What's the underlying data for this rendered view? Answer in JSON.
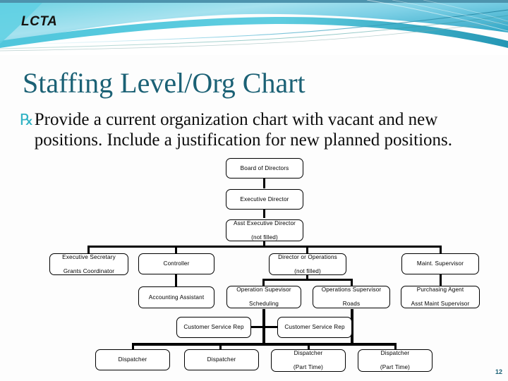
{
  "slide": {
    "logo": "LCTA",
    "title": "Staffing Level/Org Chart",
    "bullet_glyph": "℞",
    "bullet_text": "Provide a current organization chart with vacant and new positions.  Include a justification for new planned positions.",
    "page_number": "12",
    "colors": {
      "title": "#1b6175",
      "bullet": "#31b3c4",
      "banner_light": "#bfe8f2",
      "banner_mid": "#54c6db",
      "banner_deep": "#2a9cb5",
      "page_number": "#1b6175",
      "node_border": "#000000",
      "node_fill": "#ffffff"
    }
  },
  "chart_data": {
    "type": "diagram",
    "title": "Organization Chart",
    "nodes": [
      {
        "id": "board",
        "label": "Board of Directors",
        "lines": [
          "Board of Directors"
        ]
      },
      {
        "id": "execdir",
        "label": "Executive Director",
        "lines": [
          "Executive Director"
        ]
      },
      {
        "id": "asstexec",
        "label": "Asst Executive Director (not filled)",
        "lines": [
          "Asst Executive Director",
          "(not filled)"
        ]
      },
      {
        "id": "execsec",
        "label": "Executive Secretary Grants Coordinator",
        "lines": [
          "Executive Secretary",
          "Grants Coordinator"
        ]
      },
      {
        "id": "controller",
        "label": "Controller",
        "lines": [
          "Controller"
        ]
      },
      {
        "id": "dirops",
        "label": "Director or Operations (not filled)",
        "lines": [
          "Director or Operations",
          "(not filled)"
        ]
      },
      {
        "id": "maintsup",
        "label": "Maint. Supervisor",
        "lines": [
          "Maint. Supervisor"
        ]
      },
      {
        "id": "acctasst",
        "label": "Accounting Assistant",
        "lines": [
          "Accounting Assistant"
        ]
      },
      {
        "id": "opsupsched",
        "label": "Operation Supevisor Scheduling",
        "lines": [
          "Operation Supevisor",
          "Scheduling"
        ]
      },
      {
        "id": "opsuproads",
        "label": "Operations Supervisor Roads",
        "lines": [
          "Operations Supervisor",
          "Roads"
        ]
      },
      {
        "id": "purchagent",
        "label": "Purchasing Agent Asst Maint Supervisor",
        "lines": [
          "Purchasing Agent",
          "Asst Maint Supervisor"
        ]
      },
      {
        "id": "csr1",
        "label": "Customer Service Rep",
        "lines": [
          "Customer Service Rep"
        ]
      },
      {
        "id": "csr2",
        "label": "Customer Service Rep",
        "lines": [
          "Customer Service Rep"
        ]
      },
      {
        "id": "disp1",
        "label": "Dispatcher",
        "lines": [
          "Dispatcher"
        ]
      },
      {
        "id": "disp2",
        "label": "Dispatcher",
        "lines": [
          "Dispatcher"
        ]
      },
      {
        "id": "disp3",
        "label": "Dispatcher (Part Time)",
        "lines": [
          "Dispatcher",
          "(Part Time)"
        ]
      },
      {
        "id": "disp4",
        "label": "Dispatcher (Part Time)",
        "lines": [
          "Dispatcher",
          "(Part Time)"
        ]
      }
    ],
    "edges": [
      {
        "from": "board",
        "to": "execdir"
      },
      {
        "from": "execdir",
        "to": "asstexec"
      },
      {
        "from": "asstexec",
        "to": "execsec"
      },
      {
        "from": "asstexec",
        "to": "controller"
      },
      {
        "from": "asstexec",
        "to": "dirops"
      },
      {
        "from": "asstexec",
        "to": "maintsup"
      },
      {
        "from": "controller",
        "to": "acctasst"
      },
      {
        "from": "dirops",
        "to": "opsupsched"
      },
      {
        "from": "dirops",
        "to": "opsuproads"
      },
      {
        "from": "maintsup",
        "to": "purchagent"
      },
      {
        "from": "opsupsched",
        "to": "csr1"
      },
      {
        "from": "opsupsched",
        "to": "csr2"
      },
      {
        "from": "opsupsched",
        "to": "disp1"
      },
      {
        "from": "opsupsched",
        "to": "disp2"
      },
      {
        "from": "opsuproads",
        "to": "disp3"
      },
      {
        "from": "opsuproads",
        "to": "disp4"
      }
    ]
  }
}
